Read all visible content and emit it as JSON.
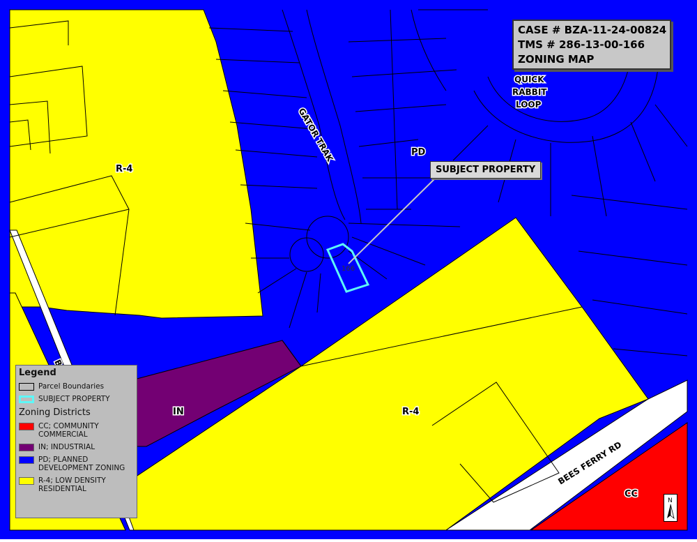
{
  "title_box": {
    "line1": "CASE # BZA-11-24-00824",
    "line2": "TMS # 286-13-00-166",
    "line3": "ZONING MAP"
  },
  "callout": {
    "label": "SUBJECT PROPERTY"
  },
  "zone_labels": {
    "r4_west": "R-4",
    "pd": "PD",
    "in": "IN",
    "r4_south": "R-4",
    "cc": "CC"
  },
  "parcel_number": "166",
  "streets": {
    "gator_trak": "GATOR TRAK",
    "quick_rabbit_1": "QUICK",
    "quick_rabbit_2": "RABBIT",
    "quick_rabbit_3": "LOOP",
    "bees_ferry": "BEES FERRY RD",
    "west_road_fragment": "B"
  },
  "north_arrow": {
    "letter": "N"
  },
  "legend": {
    "title": "Legend",
    "parcel_boundaries": "Parcel Boundaries",
    "subject_property": "SUBJECT PROPERTY",
    "zoning_heading": "Zoning Districts",
    "items": [
      {
        "label": "CC; COMMUNITY COMMERCIAL",
        "color": "#ff0000"
      },
      {
        "label": "IN; INDUSTRIAL",
        "color": "#730073"
      },
      {
        "label": "PD; PLANNED DEVELOPMENT ZONING",
        "color": "#0000ff"
      },
      {
        "label": "R-4; LOW DENSITY RESIDENTIAL",
        "color": "#ffff00"
      }
    ]
  },
  "colors": {
    "pd": "#0000ff",
    "r4": "#ffff00",
    "in": "#730073",
    "cc": "#ff0000",
    "subject_outline": "#5ef7f7"
  }
}
